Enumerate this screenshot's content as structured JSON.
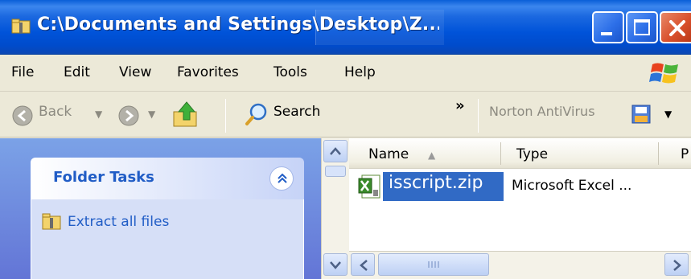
{
  "window": {
    "title": "C:\\Documents and Settings\\Desktop\\Z...",
    "caption_buttons": [
      "minimize-icon",
      "maximize-icon",
      "close-icon"
    ]
  },
  "menubar": {
    "items": [
      "File",
      "Edit",
      "View",
      "Favorites",
      "Tools",
      "Help"
    ]
  },
  "toolbar": {
    "back_label": "Back",
    "search_label": "Search",
    "overflow_label": "»",
    "norton_label": "Norton AntiVirus"
  },
  "left_pane": {
    "section_title": "Folder Tasks",
    "tasks": [
      "Extract all files"
    ]
  },
  "file_list": {
    "columns": [
      "Name",
      "Type",
      "P"
    ],
    "rows": [
      {
        "name": "isscript.zip",
        "type": "Microsoft Excel ..."
      }
    ]
  },
  "colors": {
    "titlebar": "#0053d9",
    "selection": "#316ac5",
    "task_link": "#215dc6",
    "close_button": "#d9502c"
  }
}
